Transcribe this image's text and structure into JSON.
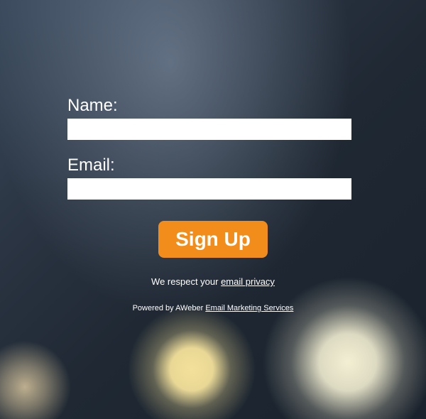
{
  "form": {
    "name": {
      "label": "Name:",
      "value": ""
    },
    "email": {
      "label": "Email:",
      "value": ""
    },
    "submit_label": "Sign Up"
  },
  "privacy": {
    "prefix": "We respect your ",
    "link_text": "email privacy"
  },
  "footer": {
    "prefix": "Powered by AWeber ",
    "link_text": "Email Marketing Services"
  }
}
